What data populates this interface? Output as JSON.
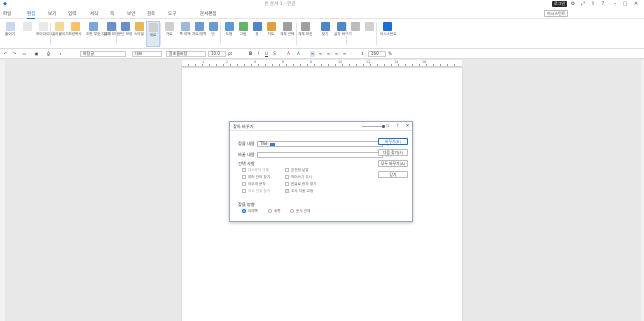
{
  "titlebar": {
    "doc_title": "빈 문서 1 - 한글",
    "login_label": "로그인"
  },
  "menu": {
    "items": [
      "파일",
      "편집",
      "보기",
      "입력",
      "서식",
      "쪽",
      "보안",
      "검토",
      "도구",
      "",
      "문서편집"
    ],
    "active": "편집",
    "ai_label": "어시스턴트"
  },
  "ribbon": {
    "items": [
      {
        "label": "붙이기",
        "icon": "paste-icon",
        "color": "#c9d8ec"
      },
      {
        "label": "",
        "icon": "scissors-icon",
        "color": "#e8e8e8"
      },
      {
        "label": "하이라이트",
        "icon": "highlight-icon",
        "color": "#e9e9e9"
      },
      {
        "label": "골라붙이기",
        "icon": "paste-special-icon",
        "color": "#f3d89a"
      },
      {
        "label": "모양복사",
        "icon": "format-copy-icon",
        "color": "#f5c36b"
      },
      {
        "label": "조판 부호 지우기",
        "icon": "eraser-icon",
        "color": "#7ba7d9"
      },
      {
        "label": "글자 모양",
        "icon": "char-shape-icon",
        "color": "#6c8fc7"
      },
      {
        "label": "문단 모양",
        "icon": "para-shape-icon",
        "color": "#6c8fc7"
      },
      {
        "label": "스타일",
        "icon": "style-icon",
        "color": "#e7b85a"
      },
      {
        "label": "세로",
        "icon": "vertical-icon",
        "color": "#cfcfcf"
      },
      {
        "label": "가로",
        "icon": "horizontal-icon",
        "color": "#cfcfcf"
      },
      {
        "label": "쪽 여백",
        "icon": "margin-icon",
        "color": "#9fb7d8"
      },
      {
        "label": "차트/영역",
        "icon": "chart-icon",
        "color": "#6c9bd2"
      },
      {
        "label": "단",
        "icon": "column-icon",
        "color": "#6c9bd2"
      },
      {
        "label": "도형",
        "icon": "shape-icon",
        "color": "#5b9bd5"
      },
      {
        "label": "그림",
        "icon": "image-icon",
        "color": "#66b36a"
      },
      {
        "label": "표",
        "icon": "table-icon",
        "color": "#4f86c6"
      },
      {
        "label": "차트",
        "icon": "bar-chart-icon",
        "color": "#e0a040"
      },
      {
        "label": "개체 선택",
        "icon": "select-icon",
        "color": "#9e9e9e"
      },
      {
        "label": "개체 보호",
        "icon": "protect-icon",
        "color": "#9e9e9e"
      },
      {
        "label": "찾기",
        "icon": "find-icon",
        "color": "#4f86c6"
      },
      {
        "label": "글자 바꾸기",
        "icon": "replace-icon",
        "color": "#4f86c6"
      },
      {
        "label": "",
        "icon": "grid-icon",
        "color": "#bcbcbc"
      },
      {
        "label": "",
        "icon": "link-icon",
        "color": "#d0d0d0"
      },
      {
        "label": "어시스턴트",
        "icon": "sparkle-icon",
        "color": "#1b6fd1"
      }
    ]
  },
  "formatbar": {
    "style": "바탕글",
    "lang": "대표",
    "font": "함초롬바탕",
    "size": "10.0",
    "unit": "pt",
    "line_spacing": "160",
    "line_unit": "%"
  },
  "ruler": {
    "labels": [
      "1",
      "2",
      "4",
      "6",
      "8",
      "10",
      "12",
      "14",
      "16"
    ]
  },
  "dialog": {
    "title": "찾아 바꾸기",
    "find_label": "찾을 내용",
    "find_value": "The",
    "replace_label": "바꿀 내용",
    "replace_value": "",
    "options_title": "선택 사항",
    "options": [
      {
        "label": "대소문자 구별",
        "checked": false,
        "dim": true
      },
      {
        "label": "온전한 낱말",
        "checked": false,
        "dim": false
      },
      {
        "label": "여러 단어 찾기",
        "checked": false,
        "dim": false
      },
      {
        "label": "띄어쓰기 무시",
        "checked": false,
        "dim": false
      },
      {
        "label": "아무개 문자",
        "checked": false,
        "dim": false
      },
      {
        "label": "한글로 한자 찾기",
        "checked": false,
        "dim": false
      },
      {
        "label": "자소 단위 찾기",
        "checked": false,
        "dim": true
      },
      {
        "label": "조사 자동 교정",
        "checked": true,
        "dim": false
      }
    ],
    "direction_title": "찾을 방향",
    "directions": [
      {
        "label": "아래쪽",
        "checked": true
      },
      {
        "label": "위쪽",
        "checked": false
      },
      {
        "label": "문서 전체",
        "checked": false
      }
    ],
    "buttons": {
      "replace": "바꾸기(R)",
      "find_next": "다음 찾기(F)",
      "replace_all": "모두 바꾸기(A)",
      "close": "닫기"
    }
  },
  "accent_color": "#1b6fd1"
}
